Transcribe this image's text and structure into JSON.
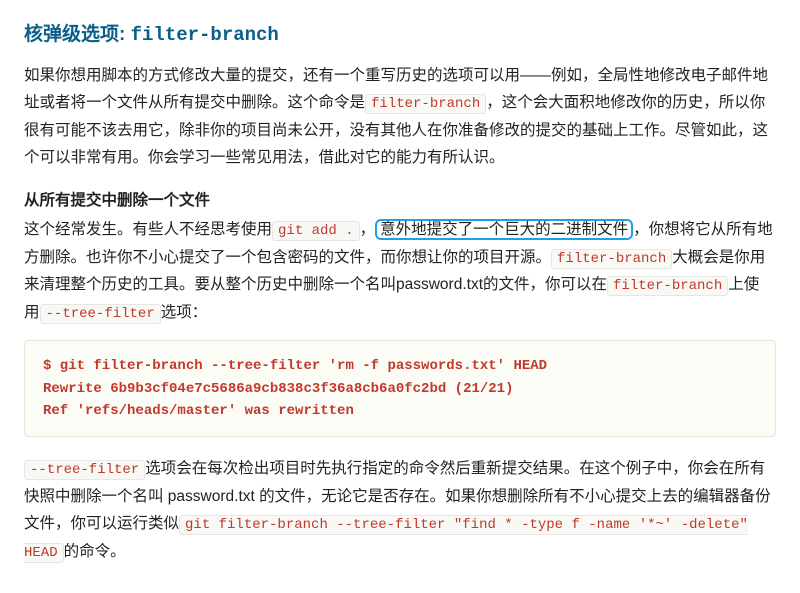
{
  "title": {
    "prefix": "核弹级选项: ",
    "code": "filter-branch"
  },
  "p1": {
    "a": "如果你想用脚本的方式修改大量的提交，还有一个重写历史的选项可以用——例如，全局性地修改电子邮件地址或者将一个文件从所有提交中删除。这个命令是",
    "code1": "filter-branch",
    "b": "，这个会大面积地修改你的历史，所以你很有可能不该去用它，除非你的项目尚未公开，没有其他人在你准备修改的提交的基础上工作。尽管如此，这个可以非常有用。你会学习一些常见用法，借此对它的能力有所认识。"
  },
  "sub": "从所有提交中删除一个文件",
  "p2": {
    "a": "这个经常发生。有些人不经思考使用",
    "code1": "git add .",
    "b": "，",
    "hl": "意外地提交了一个巨大的二进制文件",
    "c": "，你想将它从所有地方删除。也许你不小心提交了一个包含密码的文件，而你想让你的项目开源。",
    "code2": "filter-branch",
    "d": "大概会是你用来清理整个历史的工具。要从整个历史中删除一个名叫password.txt的文件，你可以在",
    "code3": "filter-branch",
    "e": "上使用",
    "code4": "--tree-filter",
    "f": "选项："
  },
  "codeblock": "$ git filter-branch --tree-filter 'rm -f passwords.txt' HEAD\nRewrite 6b9b3cf04e7c5686a9cb838c3f36a8cb6a0fc2bd (21/21)\nRef 'refs/heads/master' was rewritten",
  "p3": {
    "code1": "--tree-filter",
    "a": "选项会在每次检出项目时先执行指定的命令然后重新提交结果。在这个例子中，你会在所有快照中删除一个名叫 password.txt 的文件，无论它是否存在。如果你想删除所有不小心提交上去的编辑器备份文件，你可以运行类似",
    "code2": "git filter-branch --tree-filter \"find * -type f -name '*~' -delete\" HEAD",
    "b": "的命令。"
  }
}
